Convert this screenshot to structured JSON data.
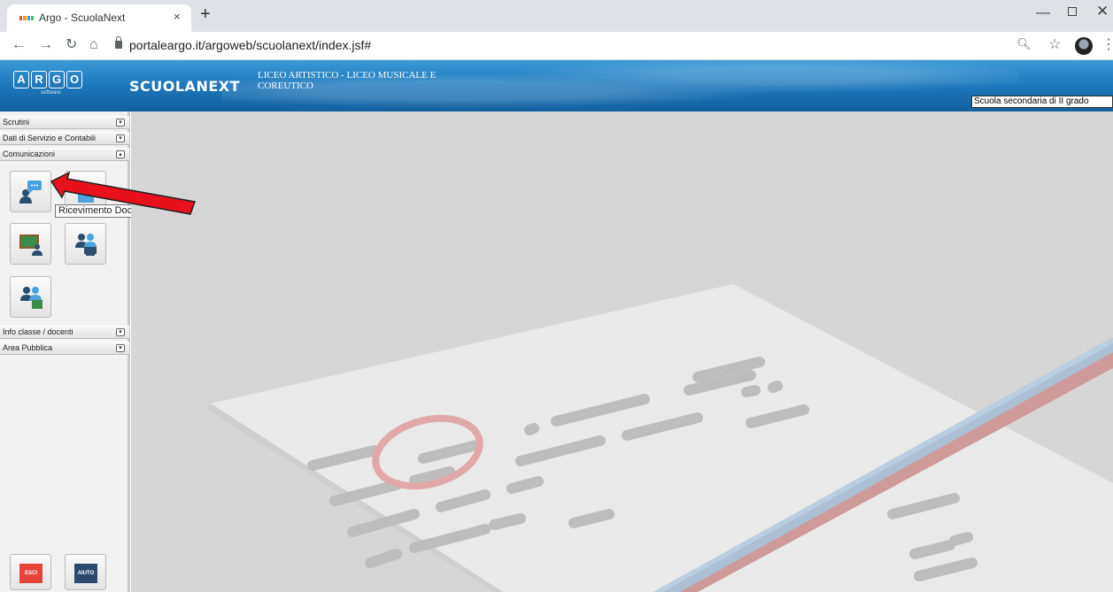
{
  "browser": {
    "tab_title": "Argo - ScuolaNext",
    "tab_close": "×",
    "new_tab": "+",
    "url": "portaleargo.it/argoweb/scuolanext/index.jsf#",
    "minimize": "—",
    "close": "✕"
  },
  "header": {
    "logo_letters": [
      "A",
      "R",
      "G",
      "O"
    ],
    "logo_sub": "software",
    "app_name": "SCUOLANEXT",
    "school_name": "LICEO ARTISTICO - LICEO MUSICALE E COREUTICO",
    "school_type_select": "Scuola secondaria di II grado"
  },
  "sidebar": {
    "menu": [
      {
        "label": "Scrutini",
        "toggle": "▾"
      },
      {
        "label": "Dati di Servizio e Contabili",
        "toggle": "▾"
      },
      {
        "label": "Comunicazioni",
        "toggle": "▴"
      },
      {
        "label": "Info classe / docenti",
        "toggle": "▾"
      },
      {
        "label": "Area Pubblica",
        "toggle": "▾"
      }
    ],
    "tooltip": "Ricevimento Docenti",
    "exit_button": "ESCI",
    "help_button": "AIUTO"
  },
  "colors": {
    "header_blue": "#1c74b8",
    "exit_red": "#e8433a",
    "help_navy": "#2c4a6e",
    "arrow_red": "#e8101a"
  }
}
